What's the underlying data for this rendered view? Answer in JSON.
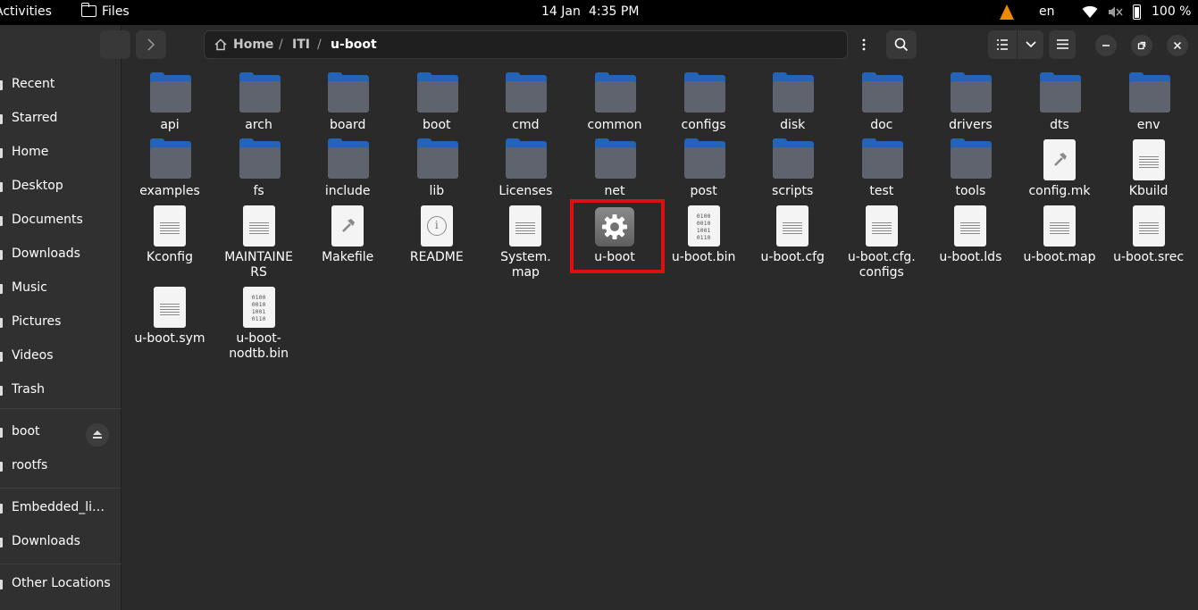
{
  "topbar": {
    "activities": "Activities",
    "app_name": "Files",
    "date": "14 Jan",
    "time": "4:35 PM",
    "language": "en",
    "battery": "100 %"
  },
  "sidebar": {
    "items": [
      {
        "label": "Recent",
        "icon": "clock-icon"
      },
      {
        "label": "Starred",
        "icon": "star-icon"
      },
      {
        "label": "Home",
        "icon": "home-icon"
      },
      {
        "label": "Desktop",
        "icon": "desktop-icon"
      },
      {
        "label": "Documents",
        "icon": "documents-icon"
      },
      {
        "label": "Downloads",
        "icon": "download-icon"
      },
      {
        "label": "Music",
        "icon": "music-icon"
      },
      {
        "label": "Pictures",
        "icon": "pictures-icon"
      },
      {
        "label": "Videos",
        "icon": "videos-icon"
      },
      {
        "label": "Trash",
        "icon": "trash-icon"
      }
    ],
    "devices": [
      {
        "label": "boot",
        "icon": "drive-icon"
      },
      {
        "label": "rootfs",
        "icon": "drive-icon"
      }
    ],
    "bookmarks": [
      {
        "label": "Embedded_li…",
        "icon": "folder-icon"
      },
      {
        "label": "Downloads",
        "icon": "folder-icon"
      }
    ],
    "other_locations": "Other Locations"
  },
  "header": {
    "path": [
      "Home",
      "ITI",
      "u-boot"
    ],
    "separator": "/"
  },
  "files": [
    {
      "name": "api",
      "type": "folder"
    },
    {
      "name": "arch",
      "type": "folder"
    },
    {
      "name": "board",
      "type": "folder"
    },
    {
      "name": "boot",
      "type": "folder"
    },
    {
      "name": "cmd",
      "type": "folder"
    },
    {
      "name": "common",
      "type": "folder"
    },
    {
      "name": "configs",
      "type": "folder"
    },
    {
      "name": "disk",
      "type": "folder"
    },
    {
      "name": "doc",
      "type": "folder"
    },
    {
      "name": "drivers",
      "type": "folder"
    },
    {
      "name": "dts",
      "type": "folder"
    },
    {
      "name": "env",
      "type": "folder"
    },
    {
      "name": "examples",
      "type": "folder"
    },
    {
      "name": "fs",
      "type": "folder"
    },
    {
      "name": "include",
      "type": "folder"
    },
    {
      "name": "lib",
      "type": "folder"
    },
    {
      "name": "Licenses",
      "type": "folder"
    },
    {
      "name": "net",
      "type": "folder"
    },
    {
      "name": "post",
      "type": "folder"
    },
    {
      "name": "scripts",
      "type": "folder"
    },
    {
      "name": "test",
      "type": "folder"
    },
    {
      "name": "tools",
      "type": "folder"
    },
    {
      "name": "config.mk",
      "type": "makefile"
    },
    {
      "name": "Kbuild",
      "type": "text"
    },
    {
      "name": "Kconfig",
      "type": "text"
    },
    {
      "name": "MAINTAINERS",
      "display": [
        "MAINTAINE",
        "RS"
      ],
      "type": "text"
    },
    {
      "name": "Makefile",
      "type": "makefile"
    },
    {
      "name": "README",
      "type": "info"
    },
    {
      "name": "System.map",
      "display": [
        "System.",
        "map"
      ],
      "type": "text"
    },
    {
      "name": "u-boot",
      "type": "executable",
      "highlighted": true
    },
    {
      "name": "u-boot.bin",
      "type": "binary"
    },
    {
      "name": "u-boot.cfg",
      "type": "text"
    },
    {
      "name": "u-boot.cfg.configs",
      "display": [
        "u-boot.cfg.",
        "configs"
      ],
      "type": "text"
    },
    {
      "name": "u-boot.lds",
      "type": "text"
    },
    {
      "name": "u-boot.map",
      "type": "text"
    },
    {
      "name": "u-boot.srec",
      "type": "text"
    },
    {
      "name": "u-boot.sym",
      "type": "text"
    },
    {
      "name": "u-boot-nodtb.bin",
      "display": [
        "u-boot-",
        "nodtb.bin"
      ],
      "type": "binary"
    }
  ],
  "binary_glyph": [
    "0100",
    "0010",
    "1001",
    "0110"
  ],
  "colors": {
    "folder_tab": "#2364b8",
    "folder_body": "#5e636d",
    "highlight": "#e00f0f",
    "background": "#2a2a2a",
    "sidebar": "#303030"
  }
}
